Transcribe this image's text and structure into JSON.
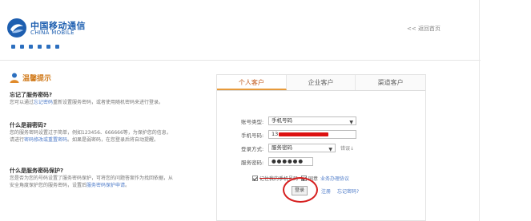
{
  "header": {
    "logo_cn": "中国移动通信",
    "logo_en": "CHINA MOBILE",
    "back_link": "<< 返回首页"
  },
  "tips": {
    "title": "温馨提示",
    "items": [
      {
        "question": "忘记了服务密码?",
        "answer_pre": "您可以通过",
        "answer_link": "忘记密码",
        "answer_post": "重新设置服务密码，或者使用随机密码来进行登录。"
      },
      {
        "question": "什么是弱密码?",
        "answer_pre": "您的服务密码设置过于简单，例如123456、666666等，为保护您的信息，请进行",
        "answer_link": "密码修改或重置密码",
        "answer_post": "。如果是弱密码，在您登录后将自动提醒。"
      },
      {
        "question": "什么是服务密码保护?",
        "answer_pre": "您是否为您的号码设置了服务密码保护，可将您的问题答案作为找回依据，从安全角度保护您的服务密码，设置后",
        "answer_link": "服务密码保护申请",
        "answer_post": "。"
      }
    ]
  },
  "login": {
    "tabs": [
      "个人客户",
      "企业客户",
      "渠道客户"
    ],
    "active_tab": 0,
    "account_type_label": "账号类型:",
    "account_type_value": "手机号码",
    "phone_label": "手机号码:",
    "phone_value": "13",
    "login_mode_label": "登录方式:",
    "login_mode_value": "服务密码",
    "verify_link": "错误↓",
    "password_label": "服务密码:",
    "password_value": "●●●●●●",
    "remember_label": "记住我的手机号码",
    "agree_label": "同意",
    "agree_link": "业务办理协议",
    "login_button": "登录",
    "register_link": "注册",
    "forgot_link": "忘记密码?"
  },
  "colors": {
    "brand_blue": "#1e5fb0",
    "tips_orange": "#d17b1c",
    "active_tab": "#c25a1c",
    "link_blue": "#4f7cc9",
    "annotation_red": "#d61f1f"
  }
}
